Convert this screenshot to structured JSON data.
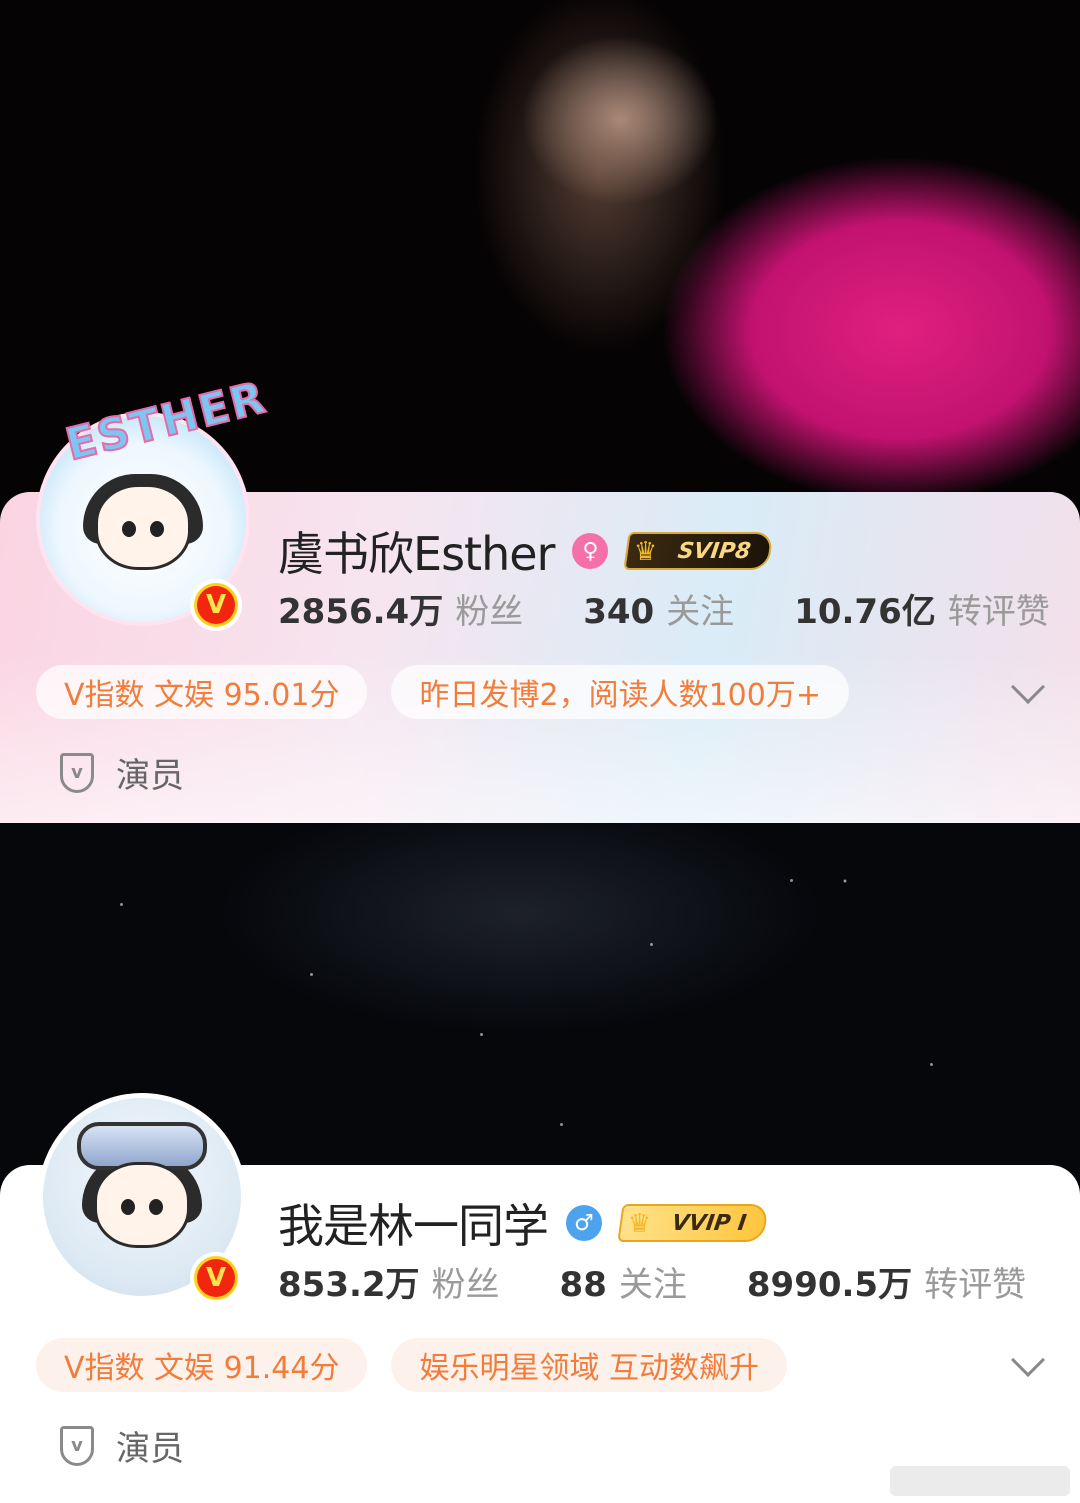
{
  "profiles": [
    {
      "name": "虞书欣Esther",
      "gender": "female",
      "vip_badge": "SVIP8",
      "avatar_text": "ESTHER",
      "verified_badge": "V",
      "stats": {
        "fans": {
          "value": "2856.4万",
          "label": "粉丝"
        },
        "following": {
          "value": "340",
          "label": "关注"
        },
        "interactions": {
          "value": "10.76亿",
          "label": "转评赞"
        }
      },
      "chips": [
        "V指数 文娱 95.01分",
        "昨日发博2，阅读人数100万+"
      ],
      "role": "演员"
    },
    {
      "name": "我是林一同学",
      "gender": "male",
      "vip_badge": "VVIP I",
      "verified_badge": "V",
      "stats": {
        "fans": {
          "value": "853.2万",
          "label": "粉丝"
        },
        "following": {
          "value": "88",
          "label": "关注"
        },
        "interactions": {
          "value": "8990.5万",
          "label": "转评赞"
        }
      },
      "chips": [
        "V指数 文娱 91.44分",
        "娱乐明星领域 互动数飙升"
      ],
      "role": "演员"
    }
  ],
  "colors": {
    "chip_text": "#f27d3a",
    "female_icon": "#f56fa9",
    "male_icon": "#4ea3ef",
    "verified_outer": "#ffd01c",
    "verified_inner": "#f2260e"
  }
}
